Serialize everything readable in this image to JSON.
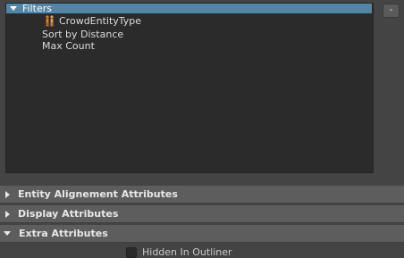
{
  "filters": {
    "title": "Filters",
    "items": [
      {
        "label": "CrowdEntityType",
        "icon": "crowd-entity-icon"
      },
      {
        "label": "Sort by Distance"
      },
      {
        "label": "Max Count"
      }
    ]
  },
  "toolbar": {
    "minus_label": "-"
  },
  "sections": [
    {
      "label": "Entity Alignement Attributes",
      "expanded": false
    },
    {
      "label": "Display Attributes",
      "expanded": false
    },
    {
      "label": "Extra Attributes",
      "expanded": true
    }
  ],
  "extra": {
    "hidden_in_outliner_label": "Hidden In Outliner",
    "hidden_in_outliner_checked": false
  },
  "colors": {
    "header_accent": "#5285a6",
    "panel_bg": "#2b2b2b",
    "section_bg": "#5d5d5d",
    "app_bg": "#444444",
    "icon_orange": "#e8821e"
  }
}
